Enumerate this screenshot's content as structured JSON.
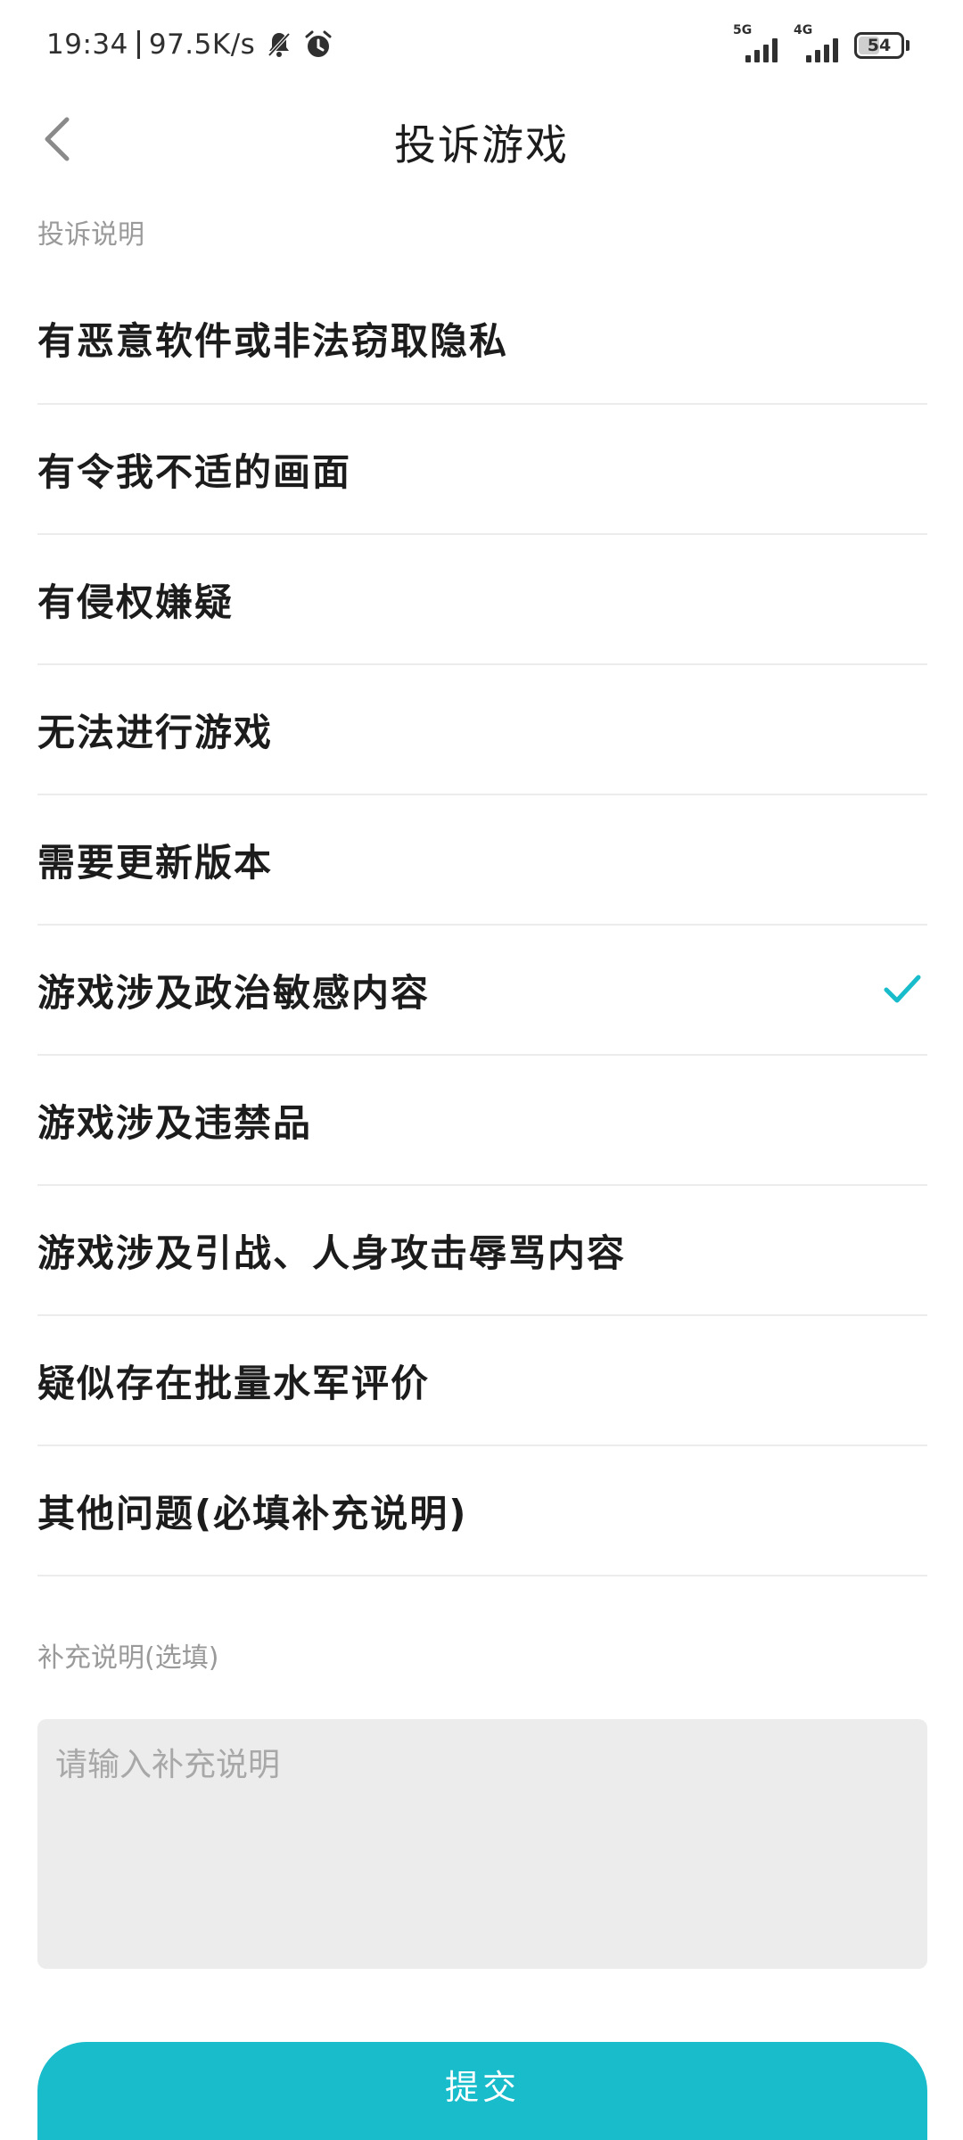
{
  "status_bar": {
    "time": "19:34",
    "net_speed": "97.5K/s",
    "icons": [
      "bell-off-icon",
      "alarm-icon"
    ],
    "signals": [
      {
        "label": "5G",
        "icon": "signal-icon"
      },
      {
        "label": "4G",
        "icon": "signal-icon"
      }
    ],
    "battery": "54",
    "battery_level": 0.54
  },
  "header": {
    "back_icon": "chevron-left-icon",
    "title": "投诉游戏"
  },
  "complaint_section_label": "投诉说明",
  "options": [
    {
      "label": "有恶意软件或非法窃取隐私",
      "selected": false
    },
    {
      "label": "有令我不适的画面",
      "selected": false
    },
    {
      "label": "有侵权嫌疑",
      "selected": false
    },
    {
      "label": "无法进行游戏",
      "selected": false
    },
    {
      "label": "需要更新版本",
      "selected": false
    },
    {
      "label": "游戏涉及政治敏感内容",
      "selected": true
    },
    {
      "label": "游戏涉及违禁品",
      "selected": false
    },
    {
      "label": "游戏涉及引战、人身攻击辱骂内容",
      "selected": false
    },
    {
      "label": "疑似存在批量水军评价",
      "selected": false
    },
    {
      "label": "其他问题(必填补充说明)",
      "selected": false
    }
  ],
  "supplement": {
    "label": "补充说明(选填)",
    "value": "",
    "placeholder": "请输入补充说明"
  },
  "submit_label": "提交",
  "colors": {
    "accent": "#19bccb",
    "check": "#19bccb",
    "text": "#1c1c1c",
    "muted": "#9a9a9a",
    "input_bg": "#ececec"
  }
}
